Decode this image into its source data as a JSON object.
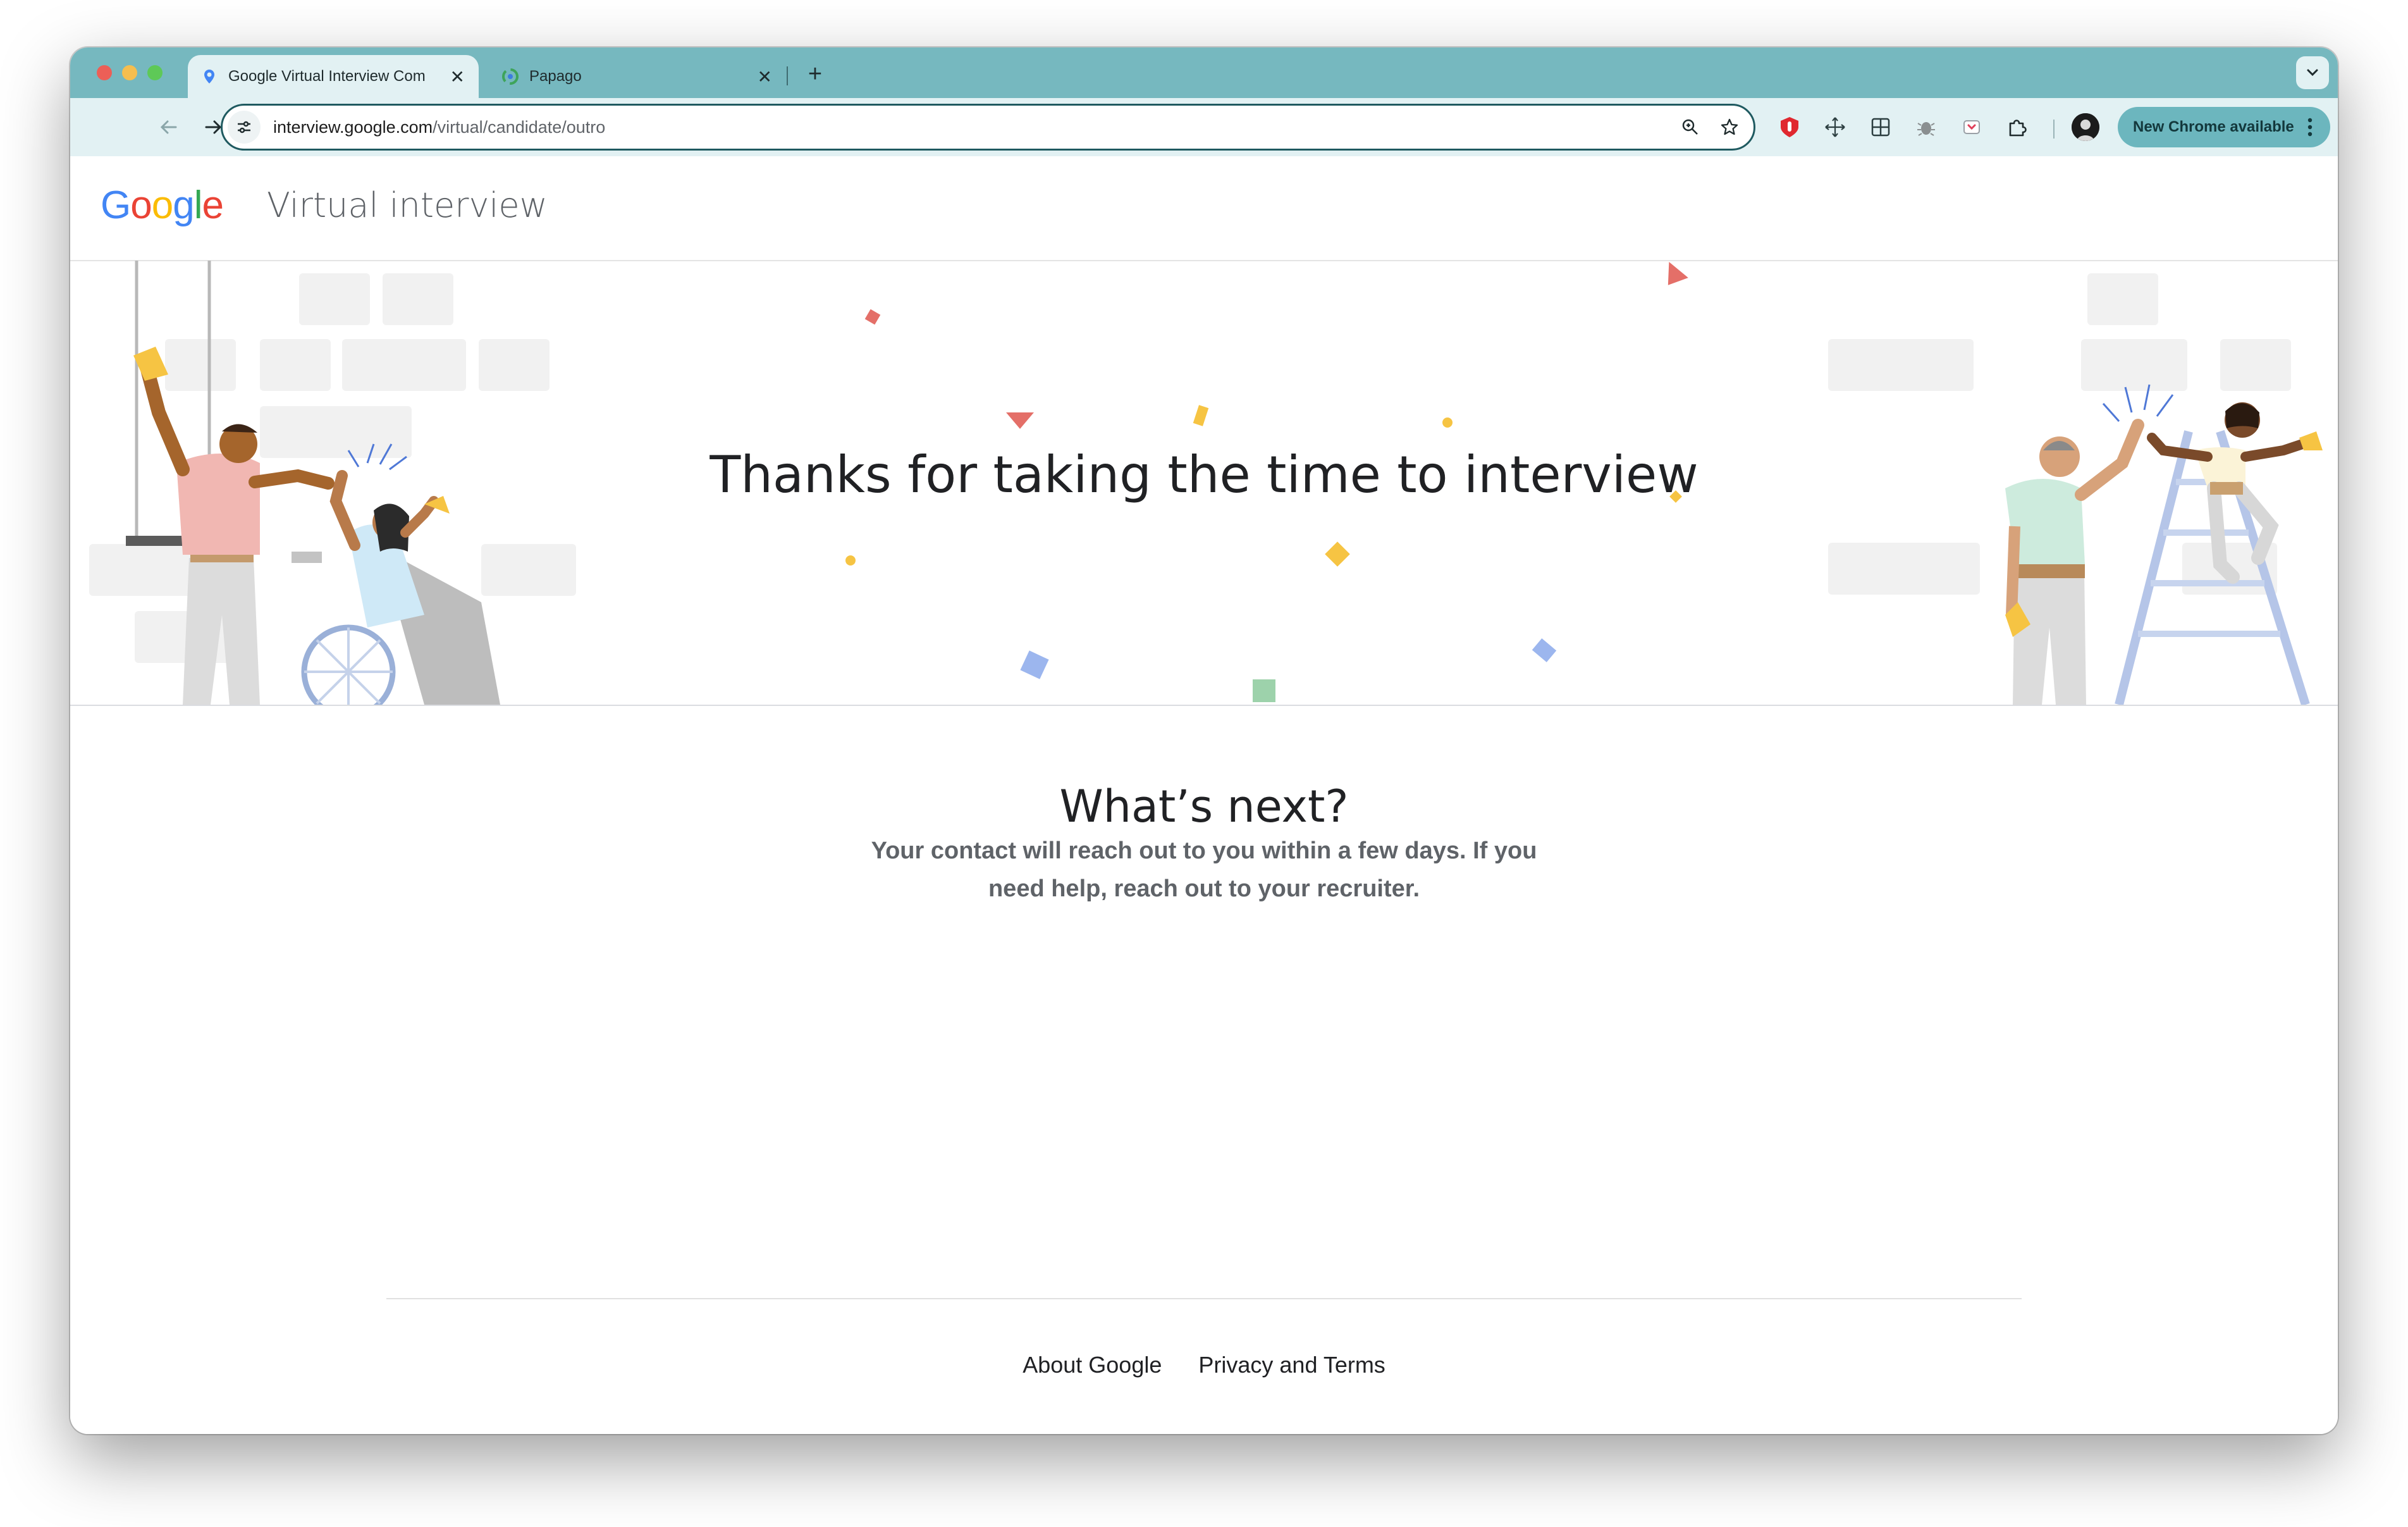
{
  "browser": {
    "tabs": [
      {
        "title": "Google Virtual Interview Com",
        "active": true
      },
      {
        "title": "Papago",
        "active": false
      }
    ],
    "new_tab_label": "+",
    "url": {
      "domain": "interview.google.com",
      "path": "/virtual/candidate/outro"
    },
    "update_button_label": "New Chrome available",
    "colors": {
      "frame": "#76b8bf",
      "toolbar": "#e2f1f3",
      "update_button": "#6cb6be"
    }
  },
  "header": {
    "logo_letters": [
      {
        "char": "G",
        "color": "#4285F4"
      },
      {
        "char": "o",
        "color": "#EA4335"
      },
      {
        "char": "o",
        "color": "#FBBC05"
      },
      {
        "char": "g",
        "color": "#4285F4"
      },
      {
        "char": "l",
        "color": "#34A853"
      },
      {
        "char": "e",
        "color": "#EA4335"
      }
    ],
    "product_name": "Virtual interview"
  },
  "hero": {
    "title": "Thanks for taking the time to interview",
    "illustrations": [
      "celebration-high-five-left",
      "celebration-high-five-right"
    ]
  },
  "next": {
    "title": "What’s next?",
    "body_line1": "Your contact will reach out to you within a few days. If you",
    "body_line2": "need help, reach out to your recruiter."
  },
  "footer": {
    "links": [
      "About Google",
      "Privacy and Terms"
    ]
  }
}
